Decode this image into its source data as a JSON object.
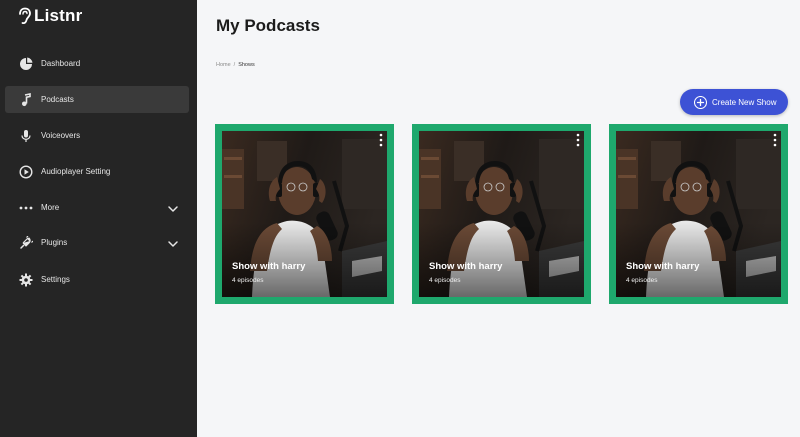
{
  "app": {
    "name": "Listnr"
  },
  "sidebar": {
    "items": [
      {
        "label": "Dashboard",
        "icon": "pie-chart-icon",
        "active": false,
        "expandable": false
      },
      {
        "label": "Podcasts",
        "icon": "music-note-icon",
        "active": true,
        "expandable": false
      },
      {
        "label": "Voiceovers",
        "icon": "microphone-icon",
        "active": false,
        "expandable": false
      },
      {
        "label": "Audioplayer Setting",
        "icon": "play-circle-icon",
        "active": false,
        "expandable": false
      },
      {
        "label": "More",
        "icon": "more-dots-icon",
        "active": false,
        "expandable": true
      },
      {
        "label": "Plugins",
        "icon": "plugin-icon",
        "active": false,
        "expandable": true
      },
      {
        "label": "Settings",
        "icon": "gear-icon",
        "active": false,
        "expandable": false
      }
    ]
  },
  "main": {
    "title": "My Podcasts",
    "breadcrumb": {
      "home": "Home",
      "separator": "/",
      "current": "Shows"
    },
    "create_button": "Create New Show",
    "shows": [
      {
        "title": "Show with harry",
        "episodes": "4 episodes"
      },
      {
        "title": "Show with harry",
        "episodes": "4 episodes"
      },
      {
        "title": "Show with harry",
        "episodes": "4 episodes"
      }
    ]
  },
  "colors": {
    "sidebar_bg": "#252525",
    "accent_green": "#1ea86d",
    "button_blue": "#3d52d5",
    "page_bg": "#f5f6f8"
  }
}
